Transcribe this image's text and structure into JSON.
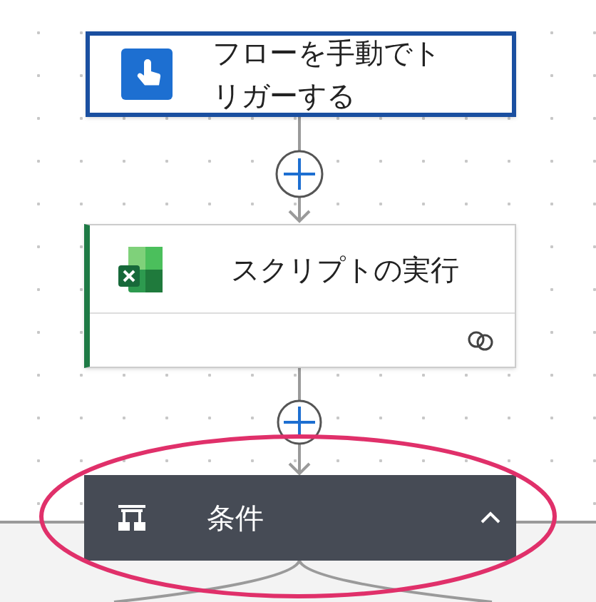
{
  "trigger": {
    "title": "フローを手動でトリガーする",
    "selected": true
  },
  "action": {
    "title": "スクリプトの実行"
  },
  "condition": {
    "title": "条件",
    "expanded": true
  }
}
